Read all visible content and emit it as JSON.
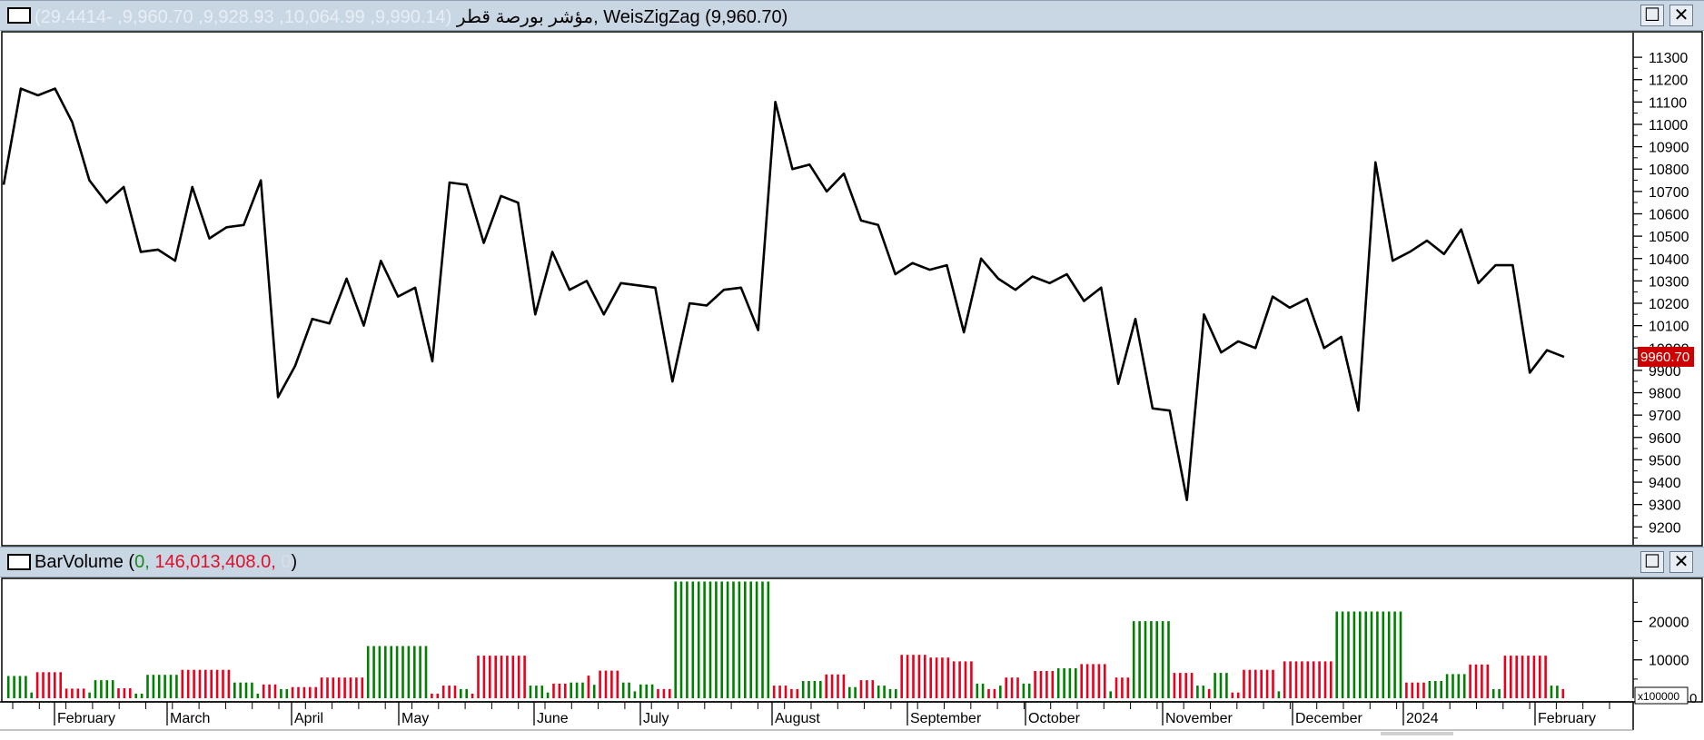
{
  "price_pane": {
    "title_name": "مؤشر بورصة قطر",
    "title_values": "(9,990.14, 10,064.99, 9,928.93, 9,960.70, -29.4414)",
    "title_sep": ",",
    "indicator_name": "WeisZigZag",
    "indicator_value": "(9,960.70)",
    "last_value_label": "9960.70",
    "maximize_glyph": "☐",
    "close_glyph": "✕"
  },
  "volume_pane": {
    "title_name": "BarVolume",
    "open_paren": "(",
    "value_1": "0,",
    "value_2": "146,013,408.0,",
    "value_3": "0",
    "close_paren": ")",
    "scale_label": "x100000",
    "zero_label": "0",
    "maximize_glyph": "☐",
    "close_glyph": "✕"
  },
  "colors": {
    "up": "#008000",
    "down": "#e8001c",
    "line": "#000000",
    "last_value_bg": "#cc0000"
  },
  "chart_data": [
    {
      "type": "line",
      "series": [
        {
          "values": [
            10730,
            11160,
            11130,
            11160,
            11010,
            10750,
            10650,
            10720,
            10430,
            10440,
            10390,
            10720,
            10490,
            10540,
            10550,
            10750,
            9780,
            9920,
            10130,
            10110,
            10310,
            10100,
            10390,
            10230,
            10270,
            9940,
            10740,
            10730,
            10470,
            10680,
            10650,
            10150,
            10430,
            10260,
            10300,
            10150,
            10290,
            10280,
            10270,
            9850,
            10200,
            10190,
            10260,
            10270,
            10080,
            11100,
            10800,
            10820,
            10700,
            10780,
            10570,
            10550,
            10330,
            10380,
            10350,
            10370,
            10070,
            10400,
            10310,
            10260,
            10320,
            10290,
            10330,
            10210,
            10270,
            9840,
            10130,
            9730,
            9720,
            9320,
            10150,
            9980,
            10030,
            10000,
            10230,
            10180,
            10220,
            10000,
            10050,
            9720,
            10830,
            10390,
            10430,
            10480,
            10420,
            10530,
            10290,
            10370,
            10370,
            9890,
            9990,
            9960
          ]
        }
      ],
      "x_labels": [
        "February",
        "March",
        "April",
        "May",
        "June",
        "July",
        "August",
        "September",
        "October",
        "November",
        "December",
        "2024",
        "February"
      ],
      "y_ticks": [
        9200,
        9300,
        9400,
        9500,
        9600,
        9700,
        9800,
        9900,
        10000,
        10100,
        10200,
        10300,
        10400,
        10500,
        10600,
        10700,
        10800,
        10900,
        11000,
        11100,
        11200,
        11300
      ],
      "y_tick_labels": [
        "9200",
        "9300",
        "9400",
        "9500",
        "9600",
        "9700",
        "9800",
        "9900",
        "10000",
        "10100",
        "10200",
        "10300",
        "10400",
        "10500",
        "10600",
        "10700",
        "10800",
        "10900",
        "11000",
        "11100",
        "11200",
        "11300"
      ],
      "ylim": [
        9120,
        11410
      ],
      "last_value": 9960.7
    },
    {
      "type": "bar",
      "groups": [
        {
          "n": 4,
          "v": 5800,
          "dir": "up"
        },
        {
          "n": 1,
          "v": 1500,
          "dir": "up"
        },
        {
          "n": 5,
          "v": 6800,
          "dir": "down"
        },
        {
          "n": 4,
          "v": 2500,
          "dir": "down"
        },
        {
          "n": 1,
          "v": 1500,
          "dir": "up"
        },
        {
          "n": 4,
          "v": 4700,
          "dir": "up"
        },
        {
          "n": 3,
          "v": 2600,
          "dir": "down"
        },
        {
          "n": 2,
          "v": 1200,
          "dir": "up"
        },
        {
          "n": 6,
          "v": 6100,
          "dir": "up"
        },
        {
          "n": 9,
          "v": 7400,
          "dir": "down"
        },
        {
          "n": 4,
          "v": 4100,
          "dir": "up"
        },
        {
          "n": 1,
          "v": 1200,
          "dir": "up"
        },
        {
          "n": 3,
          "v": 3600,
          "dir": "down"
        },
        {
          "n": 2,
          "v": 2400,
          "dir": "up"
        },
        {
          "n": 5,
          "v": 2900,
          "dir": "down"
        },
        {
          "n": 8,
          "v": 5400,
          "dir": "down"
        },
        {
          "n": 11,
          "v": 13600,
          "dir": "up"
        },
        {
          "n": 2,
          "v": 1200,
          "dir": "down"
        },
        {
          "n": 3,
          "v": 3300,
          "dir": "down"
        },
        {
          "n": 2,
          "v": 2400,
          "dir": "up"
        },
        {
          "n": 1,
          "v": 1200,
          "dir": "down"
        },
        {
          "n": 9,
          "v": 11100,
          "dir": "down"
        },
        {
          "n": 3,
          "v": 3300,
          "dir": "up"
        },
        {
          "n": 1,
          "v": 1500,
          "dir": "up"
        },
        {
          "n": 3,
          "v": 3800,
          "dir": "down"
        },
        {
          "n": 3,
          "v": 4100,
          "dir": "up"
        },
        {
          "n": 1,
          "v": 5900,
          "dir": "down"
        },
        {
          "n": 1,
          "v": 3500,
          "dir": "up"
        },
        {
          "n": 4,
          "v": 7200,
          "dir": "down"
        },
        {
          "n": 2,
          "v": 4100,
          "dir": "up"
        },
        {
          "n": 1,
          "v": 1800,
          "dir": "up"
        },
        {
          "n": 3,
          "v": 3600,
          "dir": "up"
        },
        {
          "n": 3,
          "v": 2400,
          "dir": "down"
        },
        {
          "n": 17,
          "v": 30400,
          "dir": "up"
        },
        {
          "n": 3,
          "v": 3300,
          "dir": "down"
        },
        {
          "n": 2,
          "v": 2400,
          "dir": "down"
        },
        {
          "n": 4,
          "v": 4500,
          "dir": "up"
        },
        {
          "n": 4,
          "v": 6200,
          "dir": "down"
        },
        {
          "n": 2,
          "v": 2900,
          "dir": "up"
        },
        {
          "n": 3,
          "v": 4700,
          "dir": "down"
        },
        {
          "n": 2,
          "v": 3300,
          "dir": "up"
        },
        {
          "n": 2,
          "v": 2400,
          "dir": "up"
        },
        {
          "n": 5,
          "v": 11300,
          "dir": "down"
        },
        {
          "n": 4,
          "v": 10600,
          "dir": "down"
        },
        {
          "n": 4,
          "v": 9600,
          "dir": "down"
        },
        {
          "n": 2,
          "v": 3800,
          "dir": "up"
        },
        {
          "n": 2,
          "v": 2400,
          "dir": "down"
        },
        {
          "n": 1,
          "v": 3300,
          "dir": "up"
        },
        {
          "n": 3,
          "v": 5400,
          "dir": "down"
        },
        {
          "n": 2,
          "v": 3800,
          "dir": "up"
        },
        {
          "n": 4,
          "v": 7100,
          "dir": "down"
        },
        {
          "n": 4,
          "v": 7800,
          "dir": "up"
        },
        {
          "n": 5,
          "v": 8900,
          "dir": "down"
        },
        {
          "n": 1,
          "v": 1800,
          "dir": "up"
        },
        {
          "n": 3,
          "v": 5400,
          "dir": "down"
        },
        {
          "n": 7,
          "v": 20100,
          "dir": "up"
        },
        {
          "n": 4,
          "v": 6600,
          "dir": "down"
        },
        {
          "n": 2,
          "v": 3300,
          "dir": "up"
        },
        {
          "n": 1,
          "v": 2400,
          "dir": "down"
        },
        {
          "n": 3,
          "v": 6600,
          "dir": "up"
        },
        {
          "n": 2,
          "v": 1500,
          "dir": "down"
        },
        {
          "n": 6,
          "v": 7400,
          "dir": "down"
        },
        {
          "n": 1,
          "v": 1800,
          "dir": "up"
        },
        {
          "n": 9,
          "v": 9600,
          "dir": "down"
        },
        {
          "n": 12,
          "v": 22600,
          "dir": "up"
        },
        {
          "n": 4,
          "v": 4100,
          "dir": "down"
        },
        {
          "n": 3,
          "v": 4500,
          "dir": "up"
        },
        {
          "n": 4,
          "v": 6300,
          "dir": "up"
        },
        {
          "n": 4,
          "v": 8800,
          "dir": "down"
        },
        {
          "n": 2,
          "v": 2400,
          "dir": "up"
        },
        {
          "n": 8,
          "v": 11100,
          "dir": "down"
        },
        {
          "n": 2,
          "v": 3300,
          "dir": "up"
        },
        {
          "n": 1,
          "v": 2400,
          "dir": "down"
        }
      ],
      "y_ticks": [
        10000,
        20000
      ],
      "y_tick_labels": [
        "10000",
        "20000"
      ],
      "ylim": [
        0,
        31000
      ]
    }
  ]
}
